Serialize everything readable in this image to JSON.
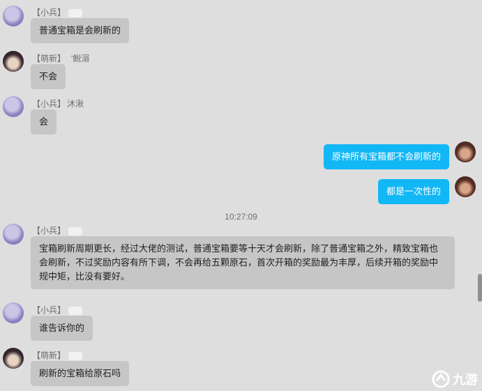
{
  "messages": [
    {
      "sender": "【小兵】",
      "text": "普通宝箱是会刷新的"
    },
    {
      "sender": "【萌新】",
      "sender_suffix": "'鲵溺",
      "text": "不会"
    },
    {
      "sender": "【小兵】",
      "sender_suffix": "沐湫",
      "text": "会"
    },
    {
      "text": "原神所有宝箱都不会刷新的"
    },
    {
      "text": "都是一次性的"
    },
    {
      "sender": "【小兵】",
      "text": "宝箱刷新周期更长，经过大佬的测试，普通宝箱要等十天才会刷新，除了普通宝箱之外，精致宝箱也会刷新，不过奖励内容有所下调，不会再给五颗原石，首次开箱的奖励最为丰厚，后续开箱的奖励中规中矩，比没有要好。"
    },
    {
      "sender": "【小兵】",
      "text": "谁告诉你的"
    },
    {
      "sender": "【萌新】",
      "text": "刷新的宝箱给原石吗"
    }
  ],
  "timestamp": "10:27:09",
  "watermark": "九游"
}
